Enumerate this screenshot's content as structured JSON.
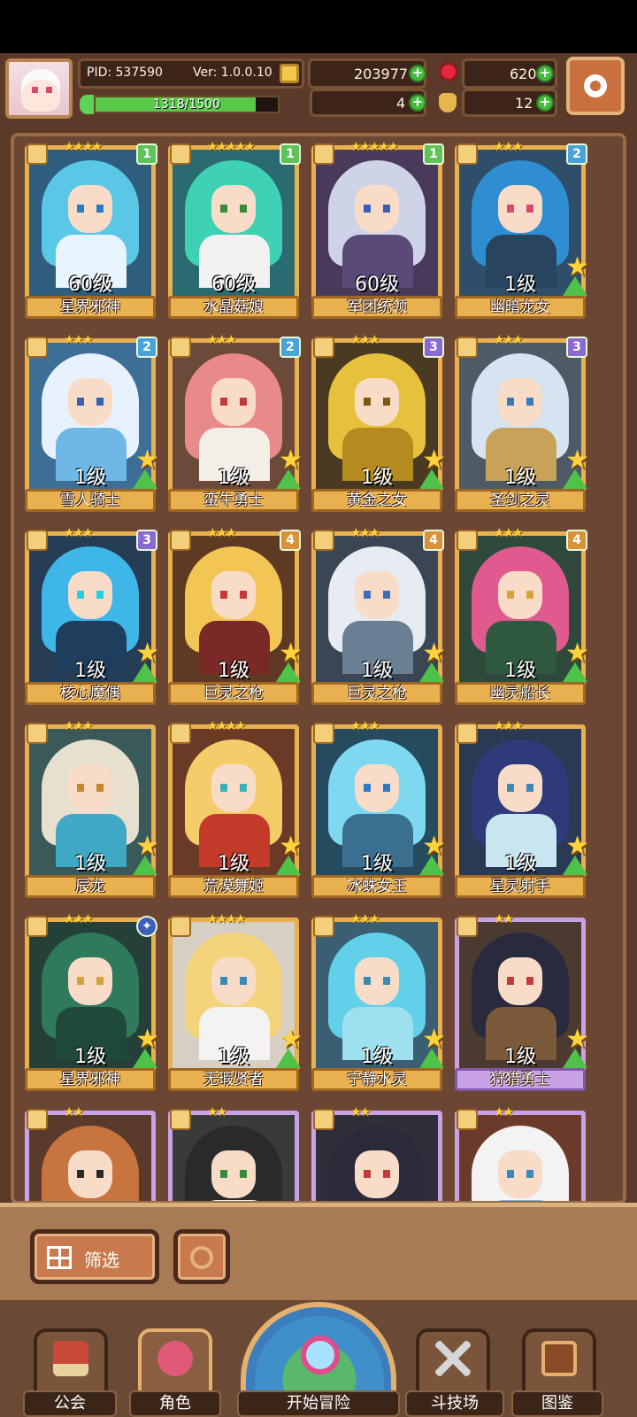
{
  "player": {
    "pid": "PID: 537590",
    "version": "Ver: 1.0.0.10",
    "xp": "1318/1500",
    "xp_fraction": 0.879
  },
  "resources": {
    "coins": "203977",
    "gems": "620",
    "clovers": "4",
    "potions": "12"
  },
  "icons": {
    "settings": "gear-icon",
    "coin": "coin-icon",
    "gem": "gem-icon",
    "clover": "clover-icon",
    "potion": "potion-icon"
  },
  "cards": [
    {
      "level": "60级",
      "name": "星界邪神",
      "tier": "1",
      "stars": "★★★★",
      "hair": "#5bc7e6",
      "body": "#e8f4ff",
      "eye": "#2a7bc4",
      "rarity": "gold",
      "bg": "#2f5d7d"
    },
    {
      "level": "60级",
      "name": "水晶菇娘",
      "tier": "1",
      "stars": "★★★★★",
      "hair": "#3fd1b4",
      "body": "#f1f1f1",
      "eye": "#3a8a3a",
      "rarity": "gold",
      "bg": "#2a6b6f"
    },
    {
      "level": "60级",
      "name": "军团统领",
      "tier": "1",
      "stars": "★★★★★",
      "hair": "#cfd3e8",
      "body": "#5b4a78",
      "eye": "#3b5fb8",
      "rarity": "gold",
      "bg": "#4a3a5a"
    },
    {
      "level": "1级",
      "name": "幽暗龙女",
      "tier": "2",
      "stars": "★★★",
      "hair": "#2f8dd1",
      "body": "#28445e",
      "eye": "#d54c6f",
      "rarity": "gold",
      "bg": "#2f4e6a"
    },
    {
      "level": "1级",
      "name": "雪人骑士",
      "tier": "2",
      "stars": "★★★",
      "hair": "#e8f2ff",
      "body": "#6fb7e6",
      "eye": "#3b5fb8",
      "rarity": "gold",
      "bg": "#3d6f96"
    },
    {
      "level": "1级",
      "name": "蛮牛勇士",
      "tier": "2",
      "stars": "★★★",
      "hair": "#e98a8a",
      "body": "#f3efe6",
      "eye": "#c43a3a",
      "rarity": "gold",
      "bg": "#6b4a3a"
    },
    {
      "level": "1级",
      "name": "黄金之女",
      "tier": "3",
      "stars": "★★★",
      "hair": "#e6c13e",
      "body": "#b58a1f",
      "eye": "#7a5a10",
      "rarity": "gold",
      "bg": "#4a3a22"
    },
    {
      "level": "1级",
      "name": "圣剑之灵",
      "tier": "3",
      "stars": "★★★",
      "hair": "#d6e3f0",
      "body": "#c9a25a",
      "eye": "#3b7ab8",
      "rarity": "gold",
      "bg": "#4e5a66"
    },
    {
      "level": "1级",
      "name": "核心魔偶",
      "tier": "3",
      "stars": "★★★",
      "hair": "#3fb6e8",
      "body": "#1f3e5e",
      "eye": "#22d1e8",
      "rarity": "gold",
      "bg": "#253d55"
    },
    {
      "level": "1级",
      "name": "巨灵之枪",
      "tier": "4",
      "stars": "★★★",
      "hair": "#f2c654",
      "body": "#7a2a26",
      "eye": "#c43a3a",
      "rarity": "gold",
      "bg": "#5e3a22"
    },
    {
      "level": "1级",
      "name": "巨灵之枪",
      "tier": "4",
      "stars": "★★★",
      "hair": "#e6ecf2",
      "body": "#6b7f93",
      "eye": "#3b6fb8",
      "rarity": "gold",
      "bg": "#3a4654"
    },
    {
      "level": "1级",
      "name": "幽灵船长",
      "tier": "4",
      "stars": "★★★",
      "hair": "#e05a8f",
      "body": "#2f5a3f",
      "eye": "#d6a23a",
      "rarity": "gold",
      "bg": "#2f4a3a"
    },
    {
      "level": "1级",
      "name": "辰龙",
      "tier": "",
      "stars": "★★★",
      "hair": "#e8e0cf",
      "body": "#3fa8c4",
      "eye": "#c48a2a",
      "rarity": "gold",
      "bg": "#3a5a5a"
    },
    {
      "level": "1级",
      "name": "荒漠舞姬",
      "tier": "",
      "stars": "★★★★",
      "hair": "#f4cd6a",
      "body": "#c43a2a",
      "eye": "#3ab0b8",
      "rarity": "gold",
      "bg": "#6b3a26"
    },
    {
      "level": "1级",
      "name": "冰蛛女王",
      "tier": "",
      "stars": "★★★",
      "hair": "#7ed8ef",
      "body": "#3a6f8f",
      "eye": "#2a7bc4",
      "rarity": "gold",
      "bg": "#264a5e"
    },
    {
      "level": "1级",
      "name": "星灵射手",
      "tier": "",
      "stars": "★★★",
      "hair": "#2f3a7a",
      "body": "#c7e6ef",
      "eye": "#3a8ab8",
      "rarity": "gold",
      "bg": "#2a3a55"
    },
    {
      "level": "1级",
      "name": "星界邪神",
      "tier": "✦",
      "stars": "★★★",
      "hair": "#2f7a5a",
      "body": "#1f4a3a",
      "eye": "#d6a23a",
      "rarity": "gold",
      "bg": "#244038"
    },
    {
      "level": "1级",
      "name": "无瑕贤者",
      "tier": "",
      "stars": "★★★★",
      "hair": "#f4d47a",
      "body": "#f3f3f3",
      "eye": "#3a8ab8",
      "rarity": "gold",
      "bg": "#d8cfc4"
    },
    {
      "level": "1级",
      "name": "宁静水灵",
      "tier": "",
      "stars": "★★★",
      "hair": "#62d0e8",
      "body": "#9fe0ef",
      "eye": "#3a8ab8",
      "rarity": "gold",
      "bg": "#3a5f73"
    },
    {
      "level": "1级",
      "name": "狩猎勇士",
      "tier": "",
      "stars": "★★",
      "hair": "#2a2a3f",
      "body": "#7a5a3a",
      "eye": "#c43a3a",
      "rarity": "purple",
      "bg": "#4a3a2f"
    },
    {
      "level": "",
      "name": "",
      "tier": "",
      "stars": "★★",
      "hair": "#c8743e",
      "body": "#c8743e",
      "eye": "#2a2a2a",
      "rarity": "purple",
      "bg": "#5a3a2a"
    },
    {
      "level": "",
      "name": "",
      "tier": "",
      "stars": "★★",
      "hair": "#2a2a2a",
      "body": "#f3f3f3",
      "eye": "#3a8a3a",
      "rarity": "purple",
      "bg": "#3a3a3a"
    },
    {
      "level": "",
      "name": "",
      "tier": "",
      "stars": "★★",
      "hair": "#2a2a3a",
      "body": "#2a2a3a",
      "eye": "#c43a3a",
      "rarity": "purple",
      "bg": "#2f2f3a"
    },
    {
      "level": "",
      "name": "",
      "tier": "",
      "stars": "★★",
      "hair": "#f3f3f3",
      "body": "#6fb7e6",
      "eye": "#3a8ab8",
      "rarity": "purple",
      "bg": "#6b3a2a"
    }
  ],
  "filter": {
    "label": "筛选"
  },
  "nav": {
    "guild": "公会",
    "character": "角色",
    "start": "开始冒险",
    "arena": "斗技场",
    "codex": "图鉴"
  }
}
